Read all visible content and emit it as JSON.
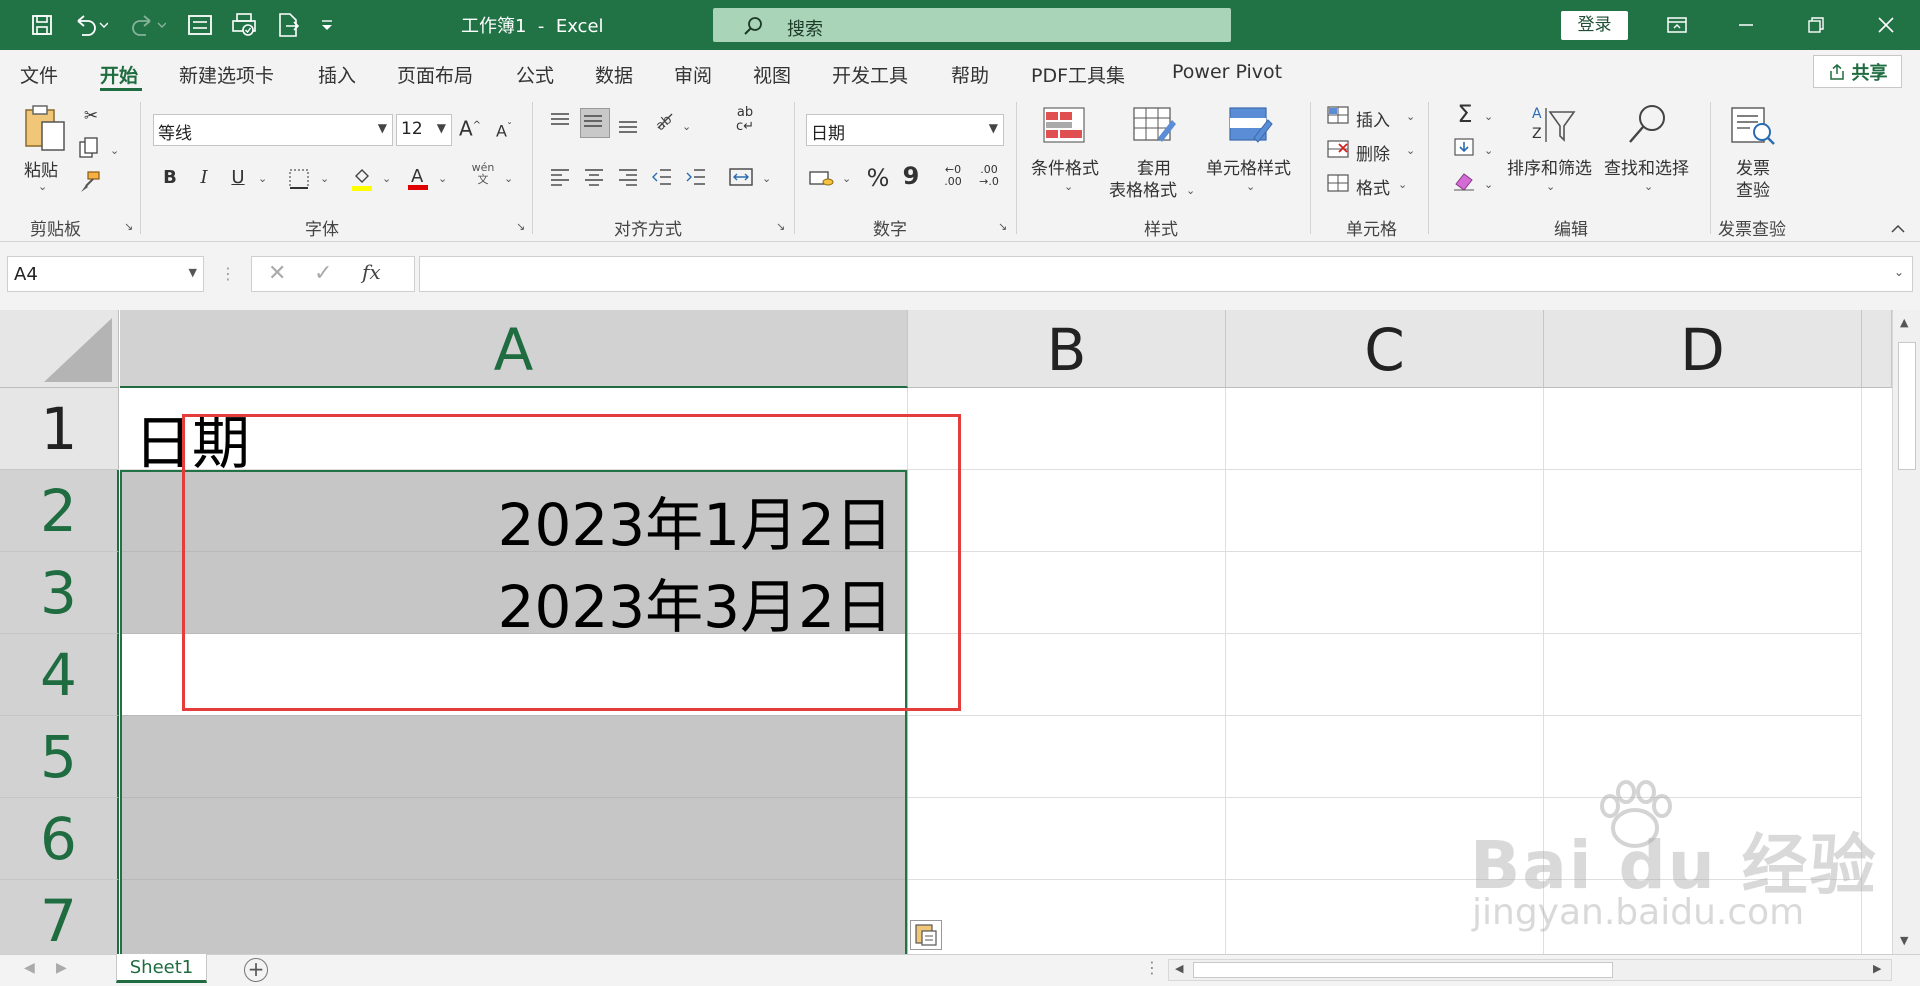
{
  "window": {
    "doc_title": "工作簿1  -  Excel",
    "search_placeholder": "搜索",
    "login_label": "登录"
  },
  "tabs": [
    {
      "label": "文件"
    },
    {
      "label": "开始",
      "active": true
    },
    {
      "label": "新建选项卡"
    },
    {
      "label": "插入"
    },
    {
      "label": "页面布局"
    },
    {
      "label": "公式"
    },
    {
      "label": "数据"
    },
    {
      "label": "审阅"
    },
    {
      "label": "视图"
    },
    {
      "label": "开发工具"
    },
    {
      "label": "帮助"
    },
    {
      "label": "PDF工具集"
    },
    {
      "label": "Power Pivot"
    }
  ],
  "share_label": "共享",
  "ribbon": {
    "clipboard": {
      "paste_label": "粘贴",
      "group_label": "剪贴板"
    },
    "font": {
      "font_name": "等线",
      "font_size": "12",
      "bold": "B",
      "italic": "I",
      "underline": "U",
      "group_label": "字体"
    },
    "alignment": {
      "group_label": "对齐方式"
    },
    "number": {
      "format": "日期",
      "percent": "%",
      "comma": "9",
      "group_label": "数字"
    },
    "styles": {
      "cond_format": "条件格式",
      "table_format_line1": "套用",
      "table_format_line2": "表格格式",
      "cell_styles": "单元格样式",
      "group_label": "样式"
    },
    "cells": {
      "insert": "插入",
      "delete": "删除",
      "format": "格式",
      "group_label": "单元格"
    },
    "editing": {
      "sort_filter": "排序和筛选",
      "find_select": "查找和选择",
      "group_label": "编辑"
    },
    "invoice": {
      "label_line1": "发票",
      "label_line2": "查验",
      "group_label": "发票查验"
    }
  },
  "formula_bar": {
    "name_box": "A4",
    "fx": "fx",
    "content": ""
  },
  "sheet": {
    "columns": [
      "A",
      "B",
      "C",
      "D"
    ],
    "rows": [
      "1",
      "2",
      "3",
      "4",
      "5",
      "6",
      "7"
    ],
    "cells": {
      "A1": "日期",
      "A2": "2023年1月2日",
      "A3": "2023年3月2日"
    },
    "selected_range": "A2:A7",
    "active_cell": "A4"
  },
  "sheet_tabs": [
    {
      "label": "Sheet1"
    }
  ],
  "watermark": {
    "brand": "Bai du 经验",
    "url": "jingyan.baidu.com"
  },
  "colors": {
    "accent": "#217346",
    "selection": "#c6c6c6",
    "highlight_box": "#e53c3c"
  }
}
